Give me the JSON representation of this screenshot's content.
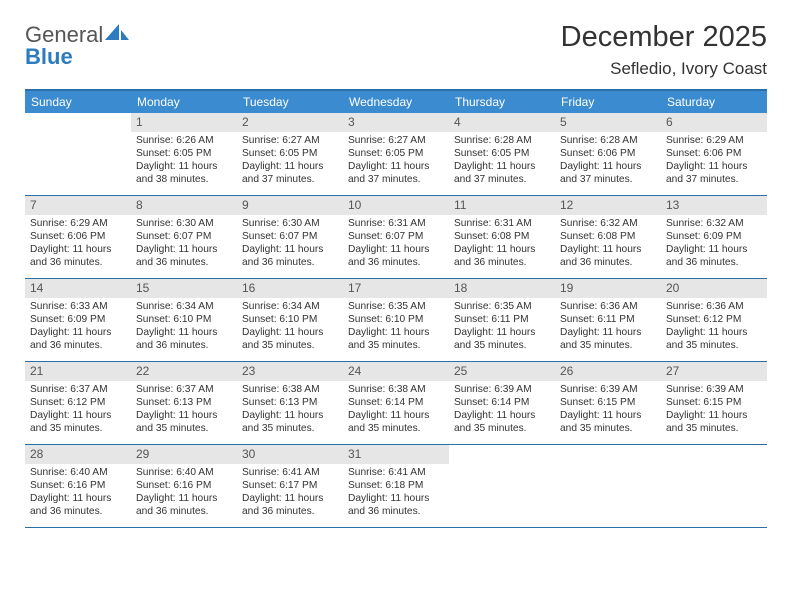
{
  "logo": {
    "word1": "General",
    "word2": "Blue"
  },
  "title": "December 2025",
  "subtitle": "Sefledio, Ivory Coast",
  "day_names": [
    "Sunday",
    "Monday",
    "Tuesday",
    "Wednesday",
    "Thursday",
    "Friday",
    "Saturday"
  ],
  "weeks": [
    [
      {
        "n": "",
        "sr": "",
        "ss": "",
        "dl": ""
      },
      {
        "n": "1",
        "sr": "Sunrise: 6:26 AM",
        "ss": "Sunset: 6:05 PM",
        "dl": "Daylight: 11 hours and 38 minutes."
      },
      {
        "n": "2",
        "sr": "Sunrise: 6:27 AM",
        "ss": "Sunset: 6:05 PM",
        "dl": "Daylight: 11 hours and 37 minutes."
      },
      {
        "n": "3",
        "sr": "Sunrise: 6:27 AM",
        "ss": "Sunset: 6:05 PM",
        "dl": "Daylight: 11 hours and 37 minutes."
      },
      {
        "n": "4",
        "sr": "Sunrise: 6:28 AM",
        "ss": "Sunset: 6:05 PM",
        "dl": "Daylight: 11 hours and 37 minutes."
      },
      {
        "n": "5",
        "sr": "Sunrise: 6:28 AM",
        "ss": "Sunset: 6:06 PM",
        "dl": "Daylight: 11 hours and 37 minutes."
      },
      {
        "n": "6",
        "sr": "Sunrise: 6:29 AM",
        "ss": "Sunset: 6:06 PM",
        "dl": "Daylight: 11 hours and 37 minutes."
      }
    ],
    [
      {
        "n": "7",
        "sr": "Sunrise: 6:29 AM",
        "ss": "Sunset: 6:06 PM",
        "dl": "Daylight: 11 hours and 36 minutes."
      },
      {
        "n": "8",
        "sr": "Sunrise: 6:30 AM",
        "ss": "Sunset: 6:07 PM",
        "dl": "Daylight: 11 hours and 36 minutes."
      },
      {
        "n": "9",
        "sr": "Sunrise: 6:30 AM",
        "ss": "Sunset: 6:07 PM",
        "dl": "Daylight: 11 hours and 36 minutes."
      },
      {
        "n": "10",
        "sr": "Sunrise: 6:31 AM",
        "ss": "Sunset: 6:07 PM",
        "dl": "Daylight: 11 hours and 36 minutes."
      },
      {
        "n": "11",
        "sr": "Sunrise: 6:31 AM",
        "ss": "Sunset: 6:08 PM",
        "dl": "Daylight: 11 hours and 36 minutes."
      },
      {
        "n": "12",
        "sr": "Sunrise: 6:32 AM",
        "ss": "Sunset: 6:08 PM",
        "dl": "Daylight: 11 hours and 36 minutes."
      },
      {
        "n": "13",
        "sr": "Sunrise: 6:32 AM",
        "ss": "Sunset: 6:09 PM",
        "dl": "Daylight: 11 hours and 36 minutes."
      }
    ],
    [
      {
        "n": "14",
        "sr": "Sunrise: 6:33 AM",
        "ss": "Sunset: 6:09 PM",
        "dl": "Daylight: 11 hours and 36 minutes."
      },
      {
        "n": "15",
        "sr": "Sunrise: 6:34 AM",
        "ss": "Sunset: 6:10 PM",
        "dl": "Daylight: 11 hours and 36 minutes."
      },
      {
        "n": "16",
        "sr": "Sunrise: 6:34 AM",
        "ss": "Sunset: 6:10 PM",
        "dl": "Daylight: 11 hours and 35 minutes."
      },
      {
        "n": "17",
        "sr": "Sunrise: 6:35 AM",
        "ss": "Sunset: 6:10 PM",
        "dl": "Daylight: 11 hours and 35 minutes."
      },
      {
        "n": "18",
        "sr": "Sunrise: 6:35 AM",
        "ss": "Sunset: 6:11 PM",
        "dl": "Daylight: 11 hours and 35 minutes."
      },
      {
        "n": "19",
        "sr": "Sunrise: 6:36 AM",
        "ss": "Sunset: 6:11 PM",
        "dl": "Daylight: 11 hours and 35 minutes."
      },
      {
        "n": "20",
        "sr": "Sunrise: 6:36 AM",
        "ss": "Sunset: 6:12 PM",
        "dl": "Daylight: 11 hours and 35 minutes."
      }
    ],
    [
      {
        "n": "21",
        "sr": "Sunrise: 6:37 AM",
        "ss": "Sunset: 6:12 PM",
        "dl": "Daylight: 11 hours and 35 minutes."
      },
      {
        "n": "22",
        "sr": "Sunrise: 6:37 AM",
        "ss": "Sunset: 6:13 PM",
        "dl": "Daylight: 11 hours and 35 minutes."
      },
      {
        "n": "23",
        "sr": "Sunrise: 6:38 AM",
        "ss": "Sunset: 6:13 PM",
        "dl": "Daylight: 11 hours and 35 minutes."
      },
      {
        "n": "24",
        "sr": "Sunrise: 6:38 AM",
        "ss": "Sunset: 6:14 PM",
        "dl": "Daylight: 11 hours and 35 minutes."
      },
      {
        "n": "25",
        "sr": "Sunrise: 6:39 AM",
        "ss": "Sunset: 6:14 PM",
        "dl": "Daylight: 11 hours and 35 minutes."
      },
      {
        "n": "26",
        "sr": "Sunrise: 6:39 AM",
        "ss": "Sunset: 6:15 PM",
        "dl": "Daylight: 11 hours and 35 minutes."
      },
      {
        "n": "27",
        "sr": "Sunrise: 6:39 AM",
        "ss": "Sunset: 6:15 PM",
        "dl": "Daylight: 11 hours and 35 minutes."
      }
    ],
    [
      {
        "n": "28",
        "sr": "Sunrise: 6:40 AM",
        "ss": "Sunset: 6:16 PM",
        "dl": "Daylight: 11 hours and 36 minutes."
      },
      {
        "n": "29",
        "sr": "Sunrise: 6:40 AM",
        "ss": "Sunset: 6:16 PM",
        "dl": "Daylight: 11 hours and 36 minutes."
      },
      {
        "n": "30",
        "sr": "Sunrise: 6:41 AM",
        "ss": "Sunset: 6:17 PM",
        "dl": "Daylight: 11 hours and 36 minutes."
      },
      {
        "n": "31",
        "sr": "Sunrise: 6:41 AM",
        "ss": "Sunset: 6:18 PM",
        "dl": "Daylight: 11 hours and 36 minutes."
      },
      {
        "n": "",
        "sr": "",
        "ss": "",
        "dl": ""
      },
      {
        "n": "",
        "sr": "",
        "ss": "",
        "dl": ""
      },
      {
        "n": "",
        "sr": "",
        "ss": "",
        "dl": ""
      }
    ]
  ]
}
